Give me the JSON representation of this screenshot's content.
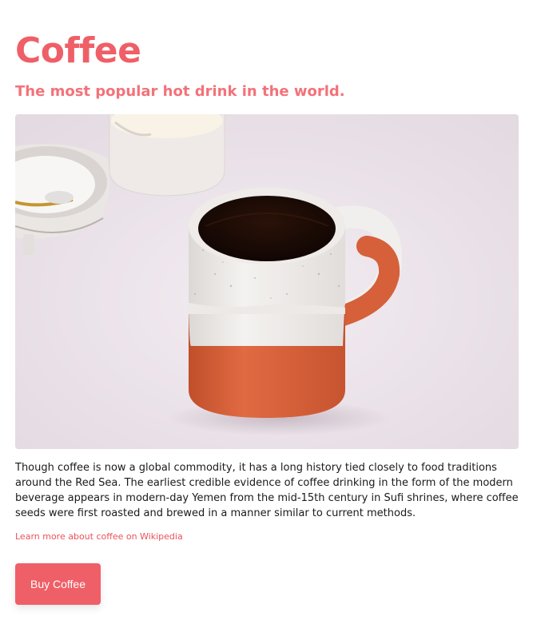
{
  "header": {
    "title": "Coffee",
    "subtitle": "The most popular hot drink in the world."
  },
  "hero_image": {
    "icon": "coffee-mug-photo"
  },
  "content": {
    "paragraph": "Though coffee is now a global commodity, it has a long history tied closely to food traditions around the Red Sea. The earliest credible evidence of coffee drinking in the form of the modern beverage appears in modern-day Yemen from the mid-15th century in Sufi shrines, where coffee seeds were first roasted and brewed in a manner similar to current methods.",
    "link_label": "Learn more about coffee on Wikipedia"
  },
  "actions": {
    "buy_label": "Buy Coffee"
  },
  "colors": {
    "accent": "#ef5f67",
    "subtitle": "#f3727a",
    "link": "#e8535b",
    "mug_orange": "#d5603a",
    "background": "#ffffff"
  }
}
